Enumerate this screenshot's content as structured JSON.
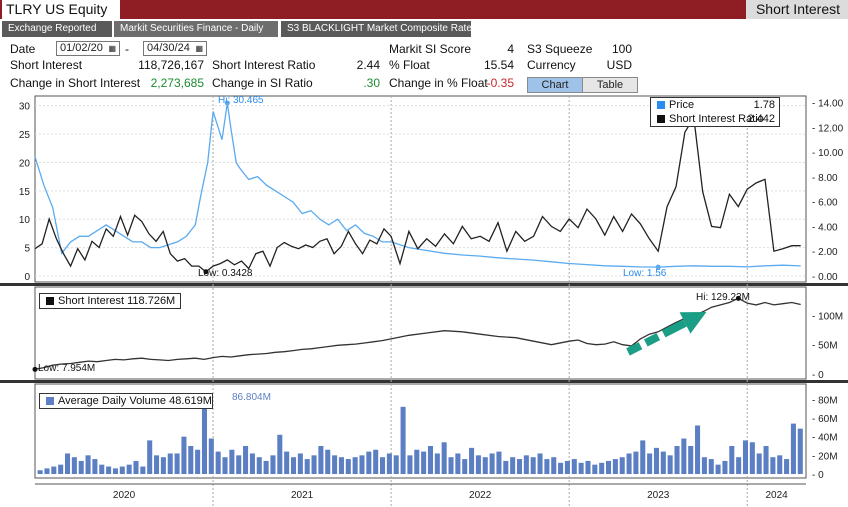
{
  "titlebar": {
    "ticker": "TLRY US Equity",
    "function": "Short Interest"
  },
  "tabs": [
    "Exchange Reported",
    "Markit Securities Finance - Daily",
    "S3 BLACKLIGHT Market Composite Rate"
  ],
  "controls": {
    "date_label": "Date",
    "start_date": "01/02/20",
    "end_date": "04/30/24",
    "dash": "-",
    "chart_button": "Chart",
    "table_button": "Table"
  },
  "stats": {
    "short_interest_label": "Short Interest",
    "short_interest": "118,726,167",
    "change_si_label": "Change in Short Interest",
    "change_si": "2,273,685",
    "si_ratio_label": "Short Interest Ratio",
    "si_ratio": "2.44",
    "change_ratio_label": "Change in SI Ratio",
    "change_ratio": ".30",
    "markit_label": "Markit SI Score",
    "markit": "4",
    "float_label": "% Float",
    "float": "15.54",
    "change_float_label": "Change in % Float",
    "change_float": "-0.35",
    "s3_label": "S3 Squeeze",
    "s3": "100",
    "currency_label": "Currency",
    "currency": "USD"
  },
  "colors": {
    "price": "#5aaaf0",
    "ratio": "#222222",
    "short_interest": "#333333",
    "volume": "#5b7fc2",
    "arrow": "#1a9e85",
    "title_bar": "#8f1d24"
  },
  "chart_data": [
    {
      "type": "line",
      "panel": "top",
      "legend": [
        {
          "name": "Price",
          "value": "1.78"
        },
        {
          "name": "Short Interest Ratio",
          "value": "2.442"
        }
      ],
      "left_axis": {
        "ticks": [
          "0",
          "5",
          "10",
          "15",
          "20",
          "25",
          "30"
        ],
        "ylim": [
          0,
          31
        ]
      },
      "right_axis": {
        "ticks": [
          "0.00",
          "2.00",
          "4.00",
          "6.00",
          "8.00",
          "10.00",
          "12.00",
          "14.00"
        ],
        "ylim": [
          0,
          14.2
        ]
      },
      "annotations": {
        "price_high": "Hi: 30.465",
        "ratio_low": "Low: 0.3428",
        "price_low": "Low: 1.56"
      },
      "series": [
        {
          "name": "Price",
          "axis": "left",
          "x": [
            2020.0,
            2020.05,
            2020.1,
            2020.15,
            2020.2,
            2020.25,
            2020.3,
            2020.35,
            2020.4,
            2020.45,
            2020.5,
            2020.55,
            2020.6,
            2020.65,
            2020.7,
            2020.75,
            2020.8,
            2020.85,
            2020.9,
            2020.93,
            2020.97,
            2021.0,
            2021.05,
            2021.08,
            2021.1,
            2021.13,
            2021.15,
            2021.2,
            2021.25,
            2021.3,
            2021.35,
            2021.4,
            2021.45,
            2021.5,
            2021.55,
            2021.6,
            2021.65,
            2021.7,
            2021.75,
            2021.8,
            2021.85,
            2021.9,
            2021.95,
            2022.0,
            2022.1,
            2022.2,
            2022.3,
            2022.4,
            2022.5,
            2022.6,
            2022.7,
            2022.8,
            2022.9,
            2023.0,
            2023.1,
            2023.2,
            2023.3,
            2023.4,
            2023.5,
            2023.6,
            2023.7,
            2023.8,
            2023.9,
            2024.0,
            2024.1,
            2024.2,
            2024.3
          ],
          "y": [
            21,
            16,
            12,
            4,
            6,
            7,
            7,
            8,
            9,
            8,
            7,
            6,
            6,
            5,
            5,
            5.5,
            6,
            7,
            9,
            14,
            20,
            29,
            24,
            30.465,
            26,
            20,
            19,
            17,
            17.5,
            16,
            15,
            14,
            13,
            11,
            11.5,
            10,
            9,
            10,
            8,
            9,
            7.5,
            7,
            6,
            6,
            5,
            4.5,
            4,
            3.7,
            3.5,
            3.2,
            3,
            2.8,
            2.5,
            2.2,
            2,
            1.8,
            1.7,
            1.6,
            1.56,
            1.7,
            1.8,
            1.7,
            1.7,
            1.6,
            1.8,
            1.9,
            1.78
          ]
        },
        {
          "name": "Short Interest Ratio",
          "axis": "right",
          "x": [
            2020.0,
            2020.04,
            2020.08,
            2020.12,
            2020.16,
            2020.2,
            2020.24,
            2020.28,
            2020.32,
            2020.36,
            2020.4,
            2020.44,
            2020.48,
            2020.52,
            2020.56,
            2020.6,
            2020.64,
            2020.68,
            2020.72,
            2020.76,
            2020.8,
            2020.84,
            2020.88,
            2020.92,
            2020.96,
            2021.0,
            2021.04,
            2021.08,
            2021.12,
            2021.16,
            2021.2,
            2021.24,
            2021.28,
            2021.32,
            2021.36,
            2021.4,
            2021.44,
            2021.48,
            2021.52,
            2021.56,
            2021.6,
            2021.64,
            2021.68,
            2021.72,
            2021.76,
            2021.8,
            2021.84,
            2021.88,
            2021.92,
            2021.96,
            2022.0,
            2022.05,
            2022.1,
            2022.15,
            2022.2,
            2022.25,
            2022.3,
            2022.35,
            2022.4,
            2022.45,
            2022.5,
            2022.55,
            2022.6,
            2022.65,
            2022.7,
            2022.75,
            2022.8,
            2022.85,
            2022.9,
            2022.95,
            2023.0,
            2023.05,
            2023.1,
            2023.15,
            2023.2,
            2023.25,
            2023.3,
            2023.35,
            2023.4,
            2023.45,
            2023.5,
            2023.55,
            2023.6,
            2023.65,
            2023.7,
            2023.75,
            2023.8,
            2023.85,
            2023.9,
            2023.95,
            2024.0,
            2024.05,
            2024.1,
            2024.15,
            2024.2,
            2024.25,
            2024.3
          ],
          "y": [
            2.2,
            2.6,
            4.6,
            3.0,
            1.8,
            0.8,
            2.2,
            1.3,
            2.8,
            2.3,
            3.8,
            3.2,
            4.8,
            3.3,
            4.9,
            4.4,
            3.4,
            2.8,
            3.6,
            1.8,
            1.2,
            1.4,
            0.8,
            0.8,
            0.3428,
            0.8,
            1.0,
            1.3,
            0.9,
            1.2,
            0.6,
            1.8,
            2.0,
            0.8,
            2.3,
            2.7,
            2.4,
            2.2,
            2.5,
            2.3,
            2.8,
            3.0,
            1.8,
            2.4,
            3.6,
            2.6,
            1.8,
            2.9,
            2.6,
            3.8,
            3.2,
            1.0,
            3.6,
            2.2,
            3.0,
            2.4,
            3.4,
            2.6,
            4.0,
            3.0,
            3.2,
            2.8,
            4.3,
            2.0,
            3.6,
            2.8,
            3.2,
            4.8,
            4.0,
            3.6,
            4.6,
            3.9,
            5.4,
            4.6,
            3.3,
            4.8,
            3.6,
            5.0,
            4.2,
            3.0,
            2.0,
            5.6,
            7.2,
            11.6,
            12.8,
            6.8,
            4.0,
            3.9,
            6.6,
            5.6,
            7.0,
            7.5,
            7.8,
            2.0,
            2.2,
            2.442,
            2.442
          ]
        }
      ]
    },
    {
      "type": "line",
      "panel": "middle",
      "legend": [
        {
          "name": "Short Interest",
          "value": "118.726M"
        }
      ],
      "right_axis": {
        "ticks": [
          "0",
          "50M",
          "100M"
        ],
        "ylim": [
          0,
          140000000
        ]
      },
      "annotations": {
        "high": "Hi: 129.22M",
        "low": "Low: 7.954M"
      },
      "series": [
        {
          "name": "Short Interest",
          "x": [
            2020.0,
            2020.05,
            2020.1,
            2020.15,
            2020.2,
            2020.25,
            2020.3,
            2020.35,
            2020.4,
            2020.45,
            2020.5,
            2020.55,
            2020.6,
            2020.65,
            2020.7,
            2020.75,
            2020.8,
            2020.85,
            2020.9,
            2020.95,
            2021.0,
            2021.05,
            2021.1,
            2021.15,
            2021.2,
            2021.25,
            2021.3,
            2021.35,
            2021.4,
            2021.45,
            2021.5,
            2021.55,
            2021.6,
            2021.65,
            2021.7,
            2021.75,
            2021.8,
            2021.85,
            2021.9,
            2021.95,
            2022.0,
            2022.1,
            2022.2,
            2022.3,
            2022.4,
            2022.5,
            2022.6,
            2022.7,
            2022.8,
            2022.9,
            2023.0,
            2023.05,
            2023.1,
            2023.15,
            2023.2,
            2023.25,
            2023.3,
            2023.35,
            2023.4,
            2023.45,
            2023.5,
            2023.55,
            2023.6,
            2023.65,
            2023.7,
            2023.75,
            2023.8,
            2023.85,
            2023.9,
            2023.95,
            2024.0,
            2024.05,
            2024.1,
            2024.15,
            2024.2,
            2024.25,
            2024.3
          ],
          "y": [
            7954000,
            11000000,
            15000000,
            17000000,
            18000000,
            20000000,
            22000000,
            21000000,
            23000000,
            25000000,
            24000000,
            26000000,
            27000000,
            25000000,
            24000000,
            23000000,
            25000000,
            26000000,
            27000000,
            25000000,
            28000000,
            30000000,
            29000000,
            31000000,
            33000000,
            34000000,
            35000000,
            37000000,
            38000000,
            40000000,
            42000000,
            43000000,
            45000000,
            47000000,
            49000000,
            50000000,
            51000000,
            53000000,
            55000000,
            57000000,
            60000000,
            66000000,
            70000000,
            74000000,
            72000000,
            68000000,
            64000000,
            62000000,
            56000000,
            50000000,
            56000000,
            58000000,
            52000000,
            50000000,
            51000000,
            55000000,
            50000000,
            48000000,
            60000000,
            68000000,
            72000000,
            80000000,
            88000000,
            95000000,
            100000000,
            106000000,
            114000000,
            118000000,
            122000000,
            129220000,
            121000000,
            118000000,
            122000000,
            118000000,
            120000000,
            122000000,
            118726000
          ]
        }
      ]
    },
    {
      "type": "bar",
      "panel": "bottom",
      "legend": [
        {
          "name": "Average Daily Volume",
          "value": "48.619M"
        }
      ],
      "right_axis": {
        "ticks": [
          "0",
          "20M",
          "40M",
          "60M",
          "80M"
        ],
        "ylim": [
          0,
          90000000
        ]
      },
      "annotations": {
        "high": "86.804M"
      },
      "series": [
        {
          "name": "Average Daily Volume",
          "values": [
            4,
            6,
            8,
            10,
            22,
            18,
            14,
            20,
            16,
            10,
            8,
            6,
            8,
            10,
            14,
            8,
            36,
            20,
            18,
            22,
            22,
            40,
            30,
            26,
            86.804,
            38,
            24,
            18,
            26,
            20,
            30,
            22,
            18,
            14,
            20,
            42,
            24,
            18,
            22,
            16,
            20,
            30,
            26,
            20,
            18,
            16,
            18,
            20,
            24,
            26,
            18,
            22,
            20,
            72,
            20,
            26,
            24,
            30,
            22,
            34,
            18,
            22,
            16,
            28,
            20,
            18,
            22,
            24,
            14,
            18,
            16,
            20,
            18,
            22,
            16,
            18,
            12,
            14,
            16,
            12,
            14,
            10,
            12,
            14,
            16,
            18,
            22,
            24,
            36,
            22,
            28,
            24,
            20,
            30,
            38,
            30,
            52,
            18,
            16,
            10,
            14,
            30,
            18,
            36,
            34,
            22,
            30,
            18,
            20,
            16,
            54,
            48.619
          ]
        }
      ]
    }
  ],
  "xaxis": {
    "ticks": [
      "2020",
      "2021",
      "2022",
      "2023",
      "2024"
    ]
  }
}
